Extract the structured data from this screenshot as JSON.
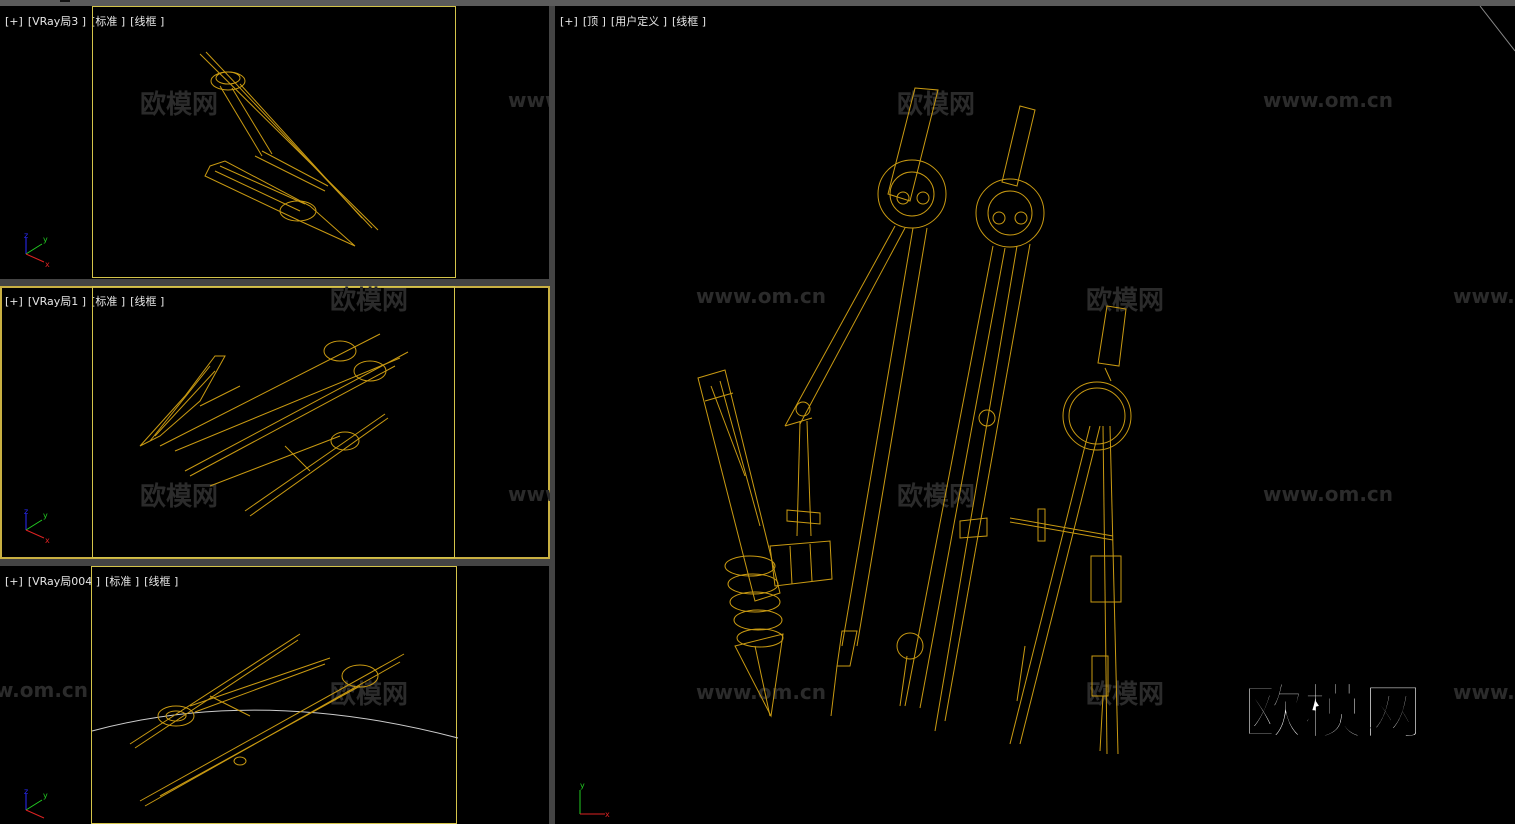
{
  "viewports": {
    "vp1": {
      "plus": "[+]",
      "name": "[VRay局3 ]",
      "shading": "[标准 ]",
      "mode": "[线框 ]"
    },
    "vp2": {
      "plus": "[+]",
      "name": "[VRay局1 ]",
      "shading": "[标准 ]",
      "mode": "[线框 ]"
    },
    "vp3": {
      "plus": "[+]",
      "name": "[VRay局004 ]",
      "shading": "[标准 ]",
      "mode": "[线框 ]"
    },
    "main": {
      "plus": "[+]",
      "name": "[顶 ]",
      "shading": "[用户定义 ]",
      "mode": "[线框 ]"
    }
  },
  "axis": {
    "x": "x",
    "y": "y",
    "z": "z"
  },
  "watermark": {
    "site": "www.om.cn",
    "brand": "欧模网"
  },
  "logo": "欧模网",
  "colors": {
    "wireframe": "#c99a12",
    "safe_frame": "#d4c44a",
    "active_border": "#c9b042",
    "background": "#000000"
  }
}
